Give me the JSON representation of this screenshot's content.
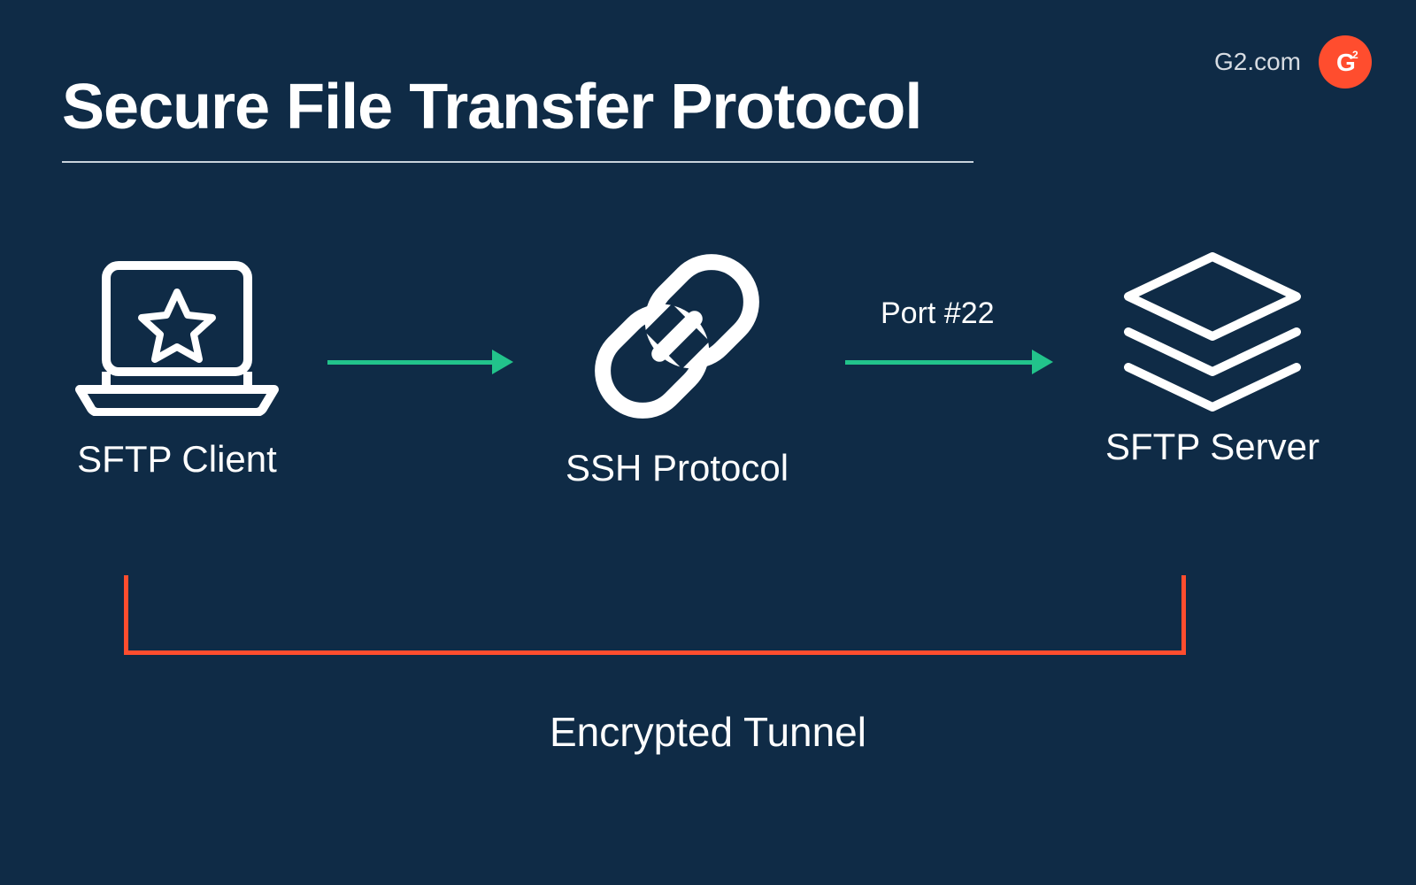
{
  "brand": {
    "site": "G2.com",
    "badge_text": "G",
    "badge_super": "2"
  },
  "title": "Secure File Transfer Protocol",
  "nodes": {
    "client": {
      "label": "SFTP Client",
      "icon": "laptop-star-icon"
    },
    "protocol": {
      "label": "SSH Protocol",
      "icon": "chain-link-icon"
    },
    "server": {
      "label": "SFTP Server",
      "icon": "layer-stack-icon"
    }
  },
  "connections": {
    "client_to_protocol": {
      "type": "arrow"
    },
    "protocol_to_server": {
      "type": "arrow",
      "label": "Port #22"
    },
    "tunnel": {
      "label": "Encrypted Tunnel"
    }
  },
  "colors": {
    "background": "#0f2b46",
    "accent_green": "#22c38b",
    "accent_red": "#ff4d2e",
    "text": "#ffffff"
  }
}
